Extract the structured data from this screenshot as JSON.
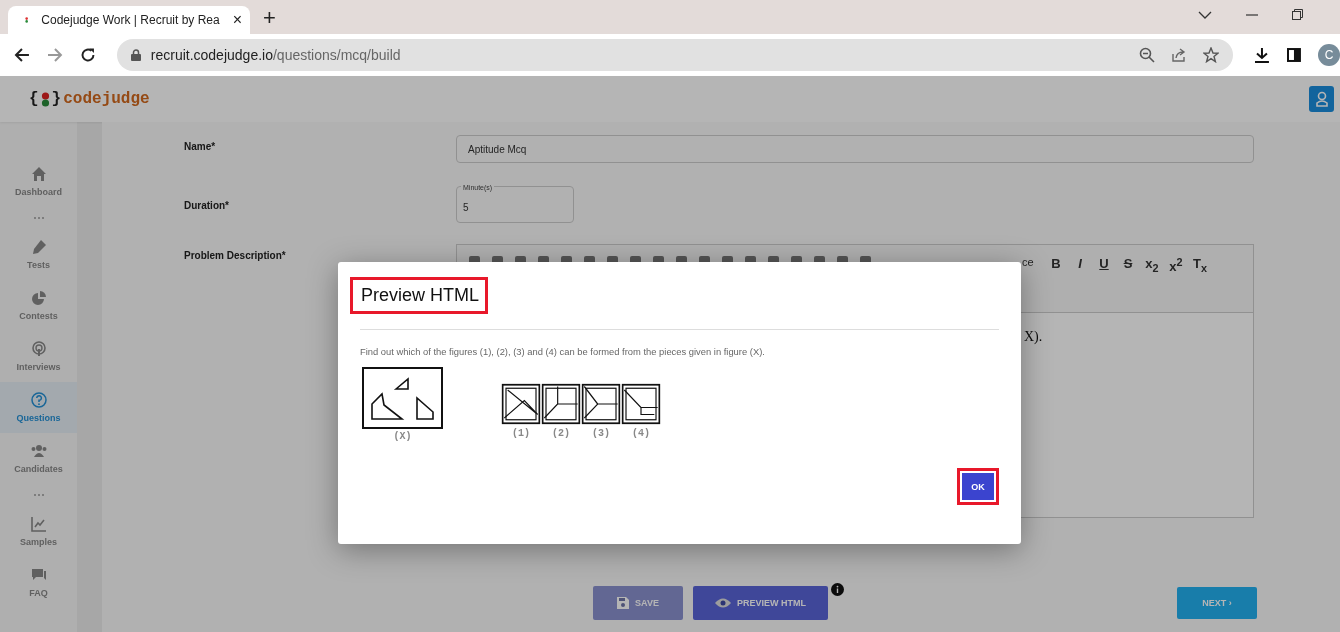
{
  "browser": {
    "tab": {
      "title": "Codejudge Work | Recruit by Rea",
      "close": "×"
    },
    "new_tab": "+",
    "url_host": "recruit.codejudge.io",
    "url_path": "/questions/mcq/build",
    "profile": "C"
  },
  "app": {
    "logo": {
      "open": "{",
      "close": "}",
      "name": "codejudge"
    }
  },
  "sidebar": {
    "items": [
      {
        "kind": "link",
        "label": "Dashboard",
        "selected": false
      },
      {
        "kind": "separator"
      },
      {
        "kind": "link",
        "label": "Tests",
        "selected": false
      },
      {
        "kind": "link",
        "label": "Contests",
        "selected": false
      },
      {
        "kind": "link",
        "label": "Interviews",
        "selected": false
      },
      {
        "kind": "link",
        "label": "Questions",
        "selected": true
      },
      {
        "kind": "link",
        "label": "Candidates",
        "selected": false
      },
      {
        "kind": "separator"
      },
      {
        "kind": "link",
        "label": "Samples",
        "selected": false
      },
      {
        "kind": "link",
        "label": "FAQ",
        "selected": false
      }
    ]
  },
  "form": {
    "name": {
      "label": "Name*",
      "value": "Aptitude Mcq"
    },
    "duration": {
      "label": "Duration*",
      "floating_label": "Minute(s)",
      "value": "5"
    },
    "description": {
      "label": "Problem Description*",
      "source_fragment": "ce",
      "format_buttons": [
        "B",
        "I",
        "U",
        "S",
        "x$_{2}$",
        "x$^{2}$",
        "T$_{x}$"
      ],
      "text_fragment": "X)."
    }
  },
  "buttons": {
    "save": "SAVE",
    "preview": "PREVIEW HTML",
    "next": "NEXT ›"
  },
  "modal": {
    "title": "Preview HTML",
    "title_highlighted": true,
    "text": "Find out which of the figures (1), (2), (3) and (4) can be formed from the pieces given in figure (X).",
    "figure_label": "(X)",
    "option_labels": [
      "(1)",
      "(2)",
      "(3)",
      "(4)"
    ],
    "ok": "OK",
    "ok_highlighted": true
  }
}
